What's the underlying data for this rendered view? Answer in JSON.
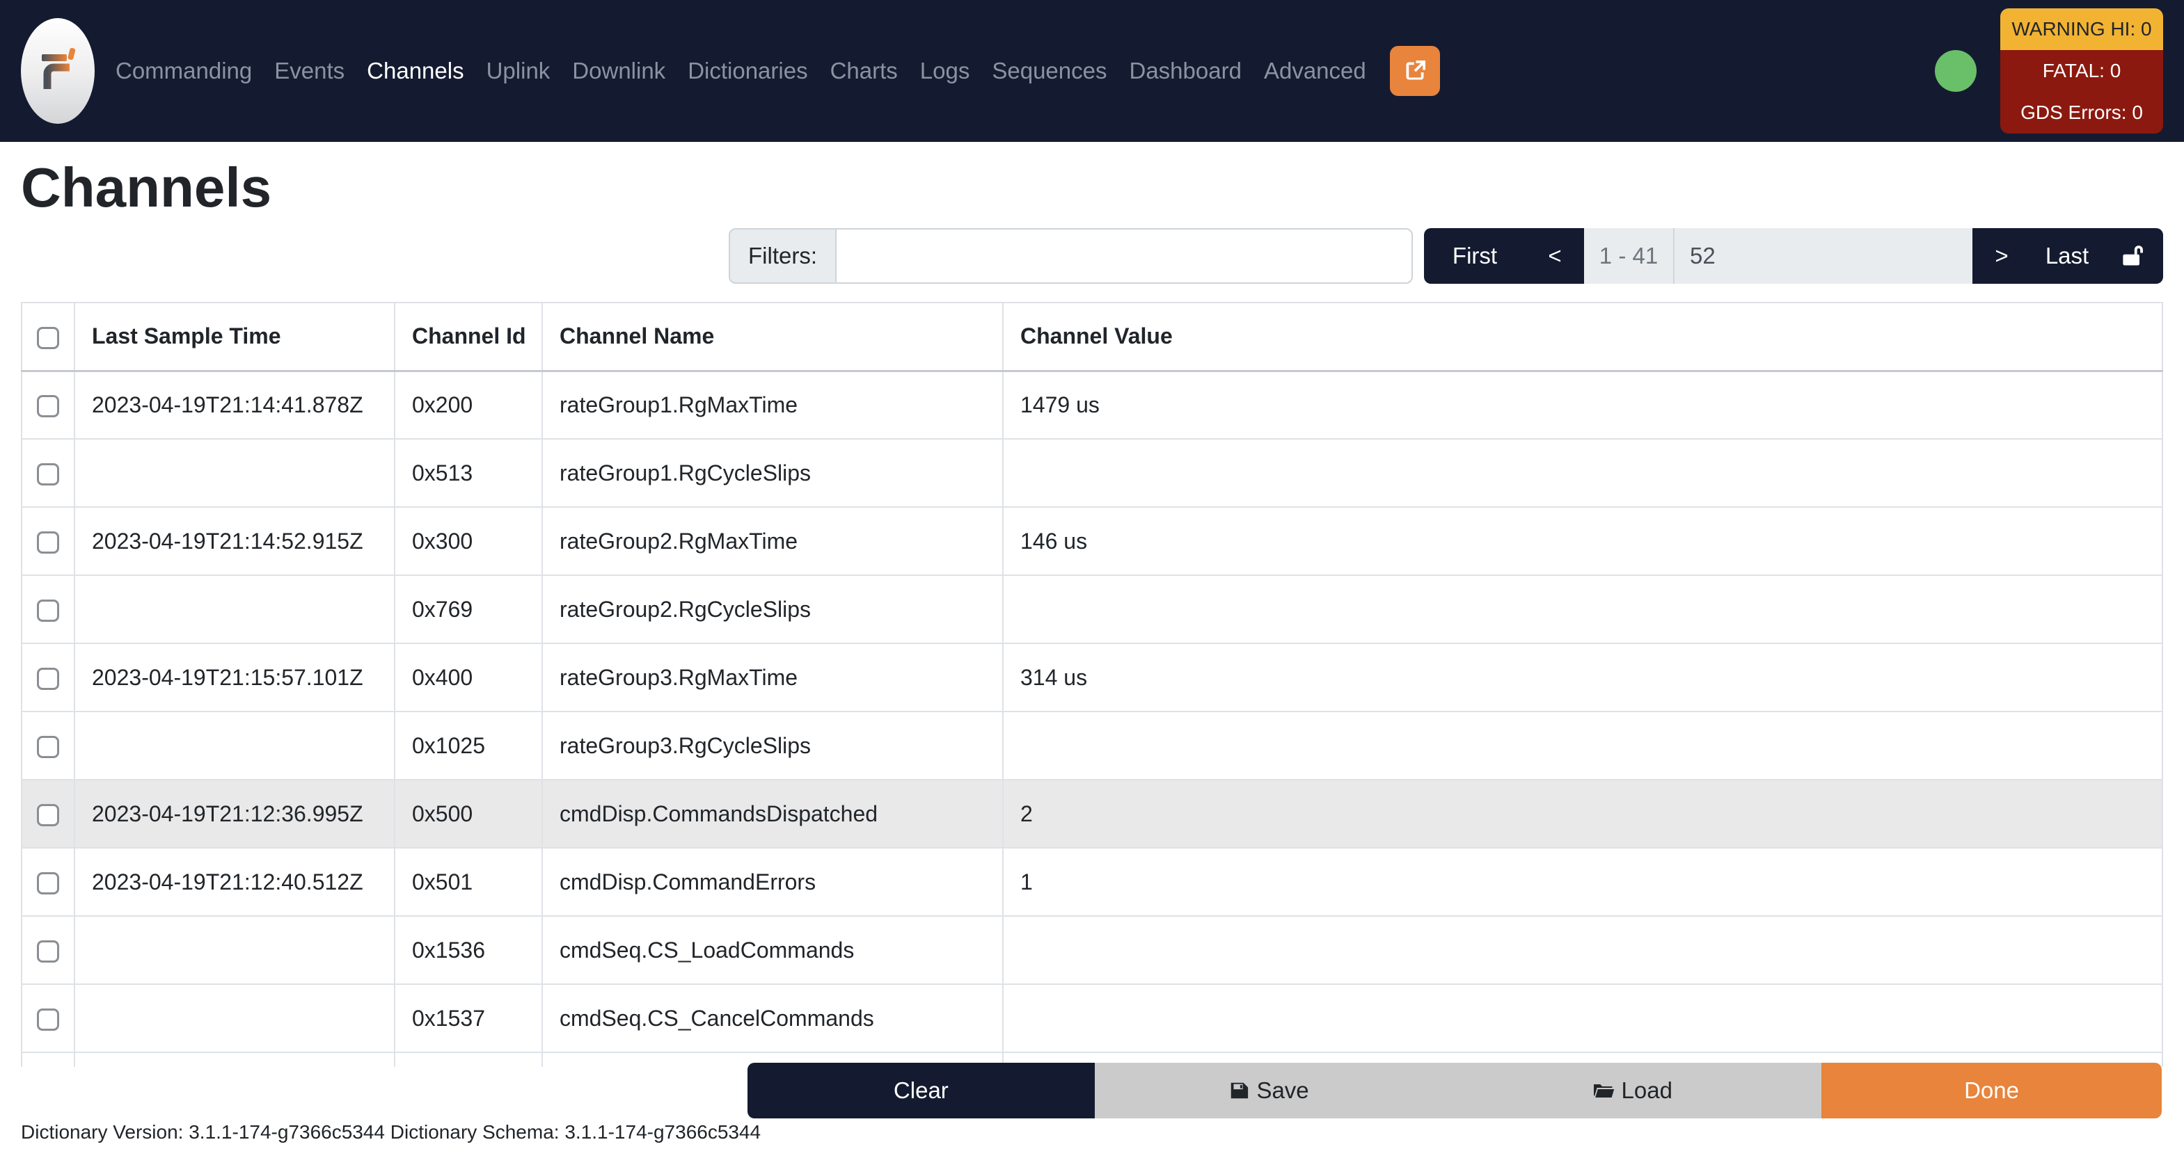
{
  "navbar": {
    "items": [
      {
        "label": "Commanding",
        "active": false
      },
      {
        "label": "Events",
        "active": false
      },
      {
        "label": "Channels",
        "active": true
      },
      {
        "label": "Uplink",
        "active": false
      },
      {
        "label": "Downlink",
        "active": false
      },
      {
        "label": "Dictionaries",
        "active": false
      },
      {
        "label": "Charts",
        "active": false
      },
      {
        "label": "Logs",
        "active": false
      },
      {
        "label": "Sequences",
        "active": false
      },
      {
        "label": "Dashboard",
        "active": false
      },
      {
        "label": "Advanced",
        "active": false
      }
    ],
    "status": {
      "warning_hi": "WARNING HI: 0",
      "fatal": "FATAL: 0",
      "gds_errors": "GDS Errors: 0"
    }
  },
  "page": {
    "title": "Channels"
  },
  "filters": {
    "label": "Filters:",
    "value": ""
  },
  "pagination": {
    "first": "First",
    "prev": "<",
    "range": "1 - 41",
    "total": "52",
    "next": ">",
    "last": "Last"
  },
  "table": {
    "columns": [
      "Last Sample Time",
      "Channel Id",
      "Channel Name",
      "Channel Value"
    ],
    "rows": [
      {
        "time": "2023-04-19T21:14:41.878Z",
        "id": "0x200",
        "name": "rateGroup1.RgMaxTime",
        "value": "1479 us",
        "highlight": false
      },
      {
        "time": "",
        "id": "0x513",
        "name": "rateGroup1.RgCycleSlips",
        "value": "",
        "highlight": false
      },
      {
        "time": "2023-04-19T21:14:52.915Z",
        "id": "0x300",
        "name": "rateGroup2.RgMaxTime",
        "value": "146 us",
        "highlight": false
      },
      {
        "time": "",
        "id": "0x769",
        "name": "rateGroup2.RgCycleSlips",
        "value": "",
        "highlight": false
      },
      {
        "time": "2023-04-19T21:15:57.101Z",
        "id": "0x400",
        "name": "rateGroup3.RgMaxTime",
        "value": "314 us",
        "highlight": false
      },
      {
        "time": "",
        "id": "0x1025",
        "name": "rateGroup3.RgCycleSlips",
        "value": "",
        "highlight": false
      },
      {
        "time": "2023-04-19T21:12:36.995Z",
        "id": "0x500",
        "name": "cmdDisp.CommandsDispatched",
        "value": "2",
        "highlight": true
      },
      {
        "time": "2023-04-19T21:12:40.512Z",
        "id": "0x501",
        "name": "cmdDisp.CommandErrors",
        "value": "1",
        "highlight": false
      },
      {
        "time": "",
        "id": "0x1536",
        "name": "cmdSeq.CS_LoadCommands",
        "value": "",
        "highlight": false
      },
      {
        "time": "",
        "id": "0x1537",
        "name": "cmdSeq.CS_CancelCommands",
        "value": "",
        "highlight": false
      },
      {
        "time": "",
        "id": "",
        "name": "",
        "value": "",
        "highlight": false
      }
    ]
  },
  "actions": {
    "clear": "Clear",
    "save": "Save",
    "load": "Load",
    "done": "Done"
  },
  "footer": {
    "version": "Dictionary Version: 3.1.1-174-g7366c5344",
    "schema": "Dictionary Schema: 3.1.1-174-g7366c5344"
  },
  "colors": {
    "navbar_bg": "#141b30",
    "accent_orange": "#e8843c",
    "warning_yellow": "#f2b332",
    "fatal_red": "#8b190f",
    "connected_green": "#6abf69",
    "row_highlight": "#e9e9e9",
    "table_border": "#dee2e6"
  },
  "icons": {
    "brand": "fprime-logo",
    "external_link": "box-arrow-up-right",
    "pagination_lock": "unlock",
    "save": "floppy-disk",
    "load": "open-folder",
    "connection": "green-circle"
  }
}
